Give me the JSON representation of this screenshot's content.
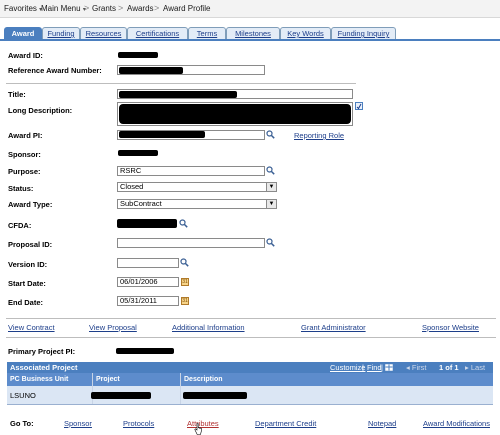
{
  "breadcrumb": {
    "items": [
      {
        "label": "Favorites",
        "dropdown": true
      },
      {
        "label": "Main Menu",
        "dropdown": true
      },
      {
        "label": "Grants",
        "dropdown": false
      },
      {
        "label": "Awards",
        "dropdown": false
      },
      {
        "label": "Award Profile",
        "dropdown": false
      }
    ],
    "separator": ">"
  },
  "tabs": [
    {
      "label": "Award",
      "active": true
    },
    {
      "label": "Funding"
    },
    {
      "label": "Resources"
    },
    {
      "label": "Certifications"
    },
    {
      "label": "Terms"
    },
    {
      "label": "Milestones"
    },
    {
      "label": "Key Words"
    },
    {
      "label": "Funding Inquiry"
    }
  ],
  "form": {
    "award_id_label": "Award ID:",
    "ref_award_label": "Reference Award Number:",
    "title_label": "Title:",
    "long_desc_label": "Long Description:",
    "award_pi_label": "Award PI:",
    "reporting_role_link": "Reporting Role",
    "sponsor_label": "Sponsor:",
    "purpose_label": "Purpose:",
    "purpose_value": "RSRC",
    "status_label": "Status:",
    "status_value": "Closed",
    "award_type_label": "Award Type:",
    "award_type_value": "SubContract",
    "cfda_label": "CFDA:",
    "proposal_id_label": "Proposal ID:",
    "proposal_id_value": "",
    "version_id_label": "Version ID:",
    "version_id_value": "",
    "start_date_label": "Start Date:",
    "start_date_value": "06/01/2006",
    "end_date_label": "End Date:",
    "end_date_value": "05/31/2011"
  },
  "links": {
    "view_contract": "View Contract",
    "view_proposal": "View Proposal",
    "additional_information": "Additional Information",
    "grant_administrator": "Grant Administrator",
    "sponsor_website": "Sponsor Website"
  },
  "primary_project_label": "Primary Project PI:",
  "associated_project": {
    "title": "Associated Project",
    "customize": "Customize",
    "find": "Find",
    "first": "First",
    "range": "1 of 1",
    "last": "Last",
    "columns": [
      "PC Business Unit",
      "Project",
      "Description"
    ],
    "rows": [
      [
        "LSUNO",
        "",
        ""
      ]
    ]
  },
  "goto": {
    "label": "Go To:",
    "items": [
      "Sponsor",
      "Protocols",
      "Attributes",
      "Department Credit",
      "Notepad",
      "Award Modifications"
    ]
  },
  "colors": {
    "tab_blue": "#4b7fbf",
    "link_blue": "#1d3e8a"
  },
  "icons": [
    "lookup-icon",
    "calendar-icon",
    "spellcheck-icon",
    "dropdown-arrow-icon",
    "mouse-pointer-icon"
  ]
}
